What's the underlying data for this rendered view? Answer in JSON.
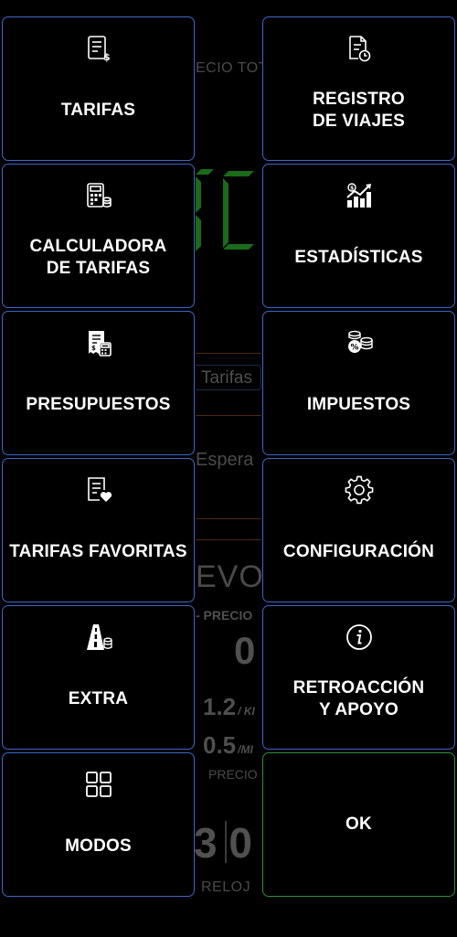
{
  "background": {
    "precio_total": "ECIO TOT",
    "tarifas": "Tarifas",
    "espera": "Espera",
    "nuevo": "EVO V",
    "precio_small": "- PRECIO",
    "zero": "0",
    "rate1": "1.2",
    "rate1_unit": "/ KI",
    "rate2": "0.5",
    "rate2_unit": "/MI",
    "precio": "PRECIO",
    "clock_digits": "3   0",
    "reloj": "RELOJ",
    "digit_color": "#1a6b1a"
  },
  "menu": {
    "tiles": [
      {
        "label": "TARIFAS",
        "icon": "invoice-dollar-icon"
      },
      {
        "label": "REGISTRO\nDE VIAJES",
        "icon": "document-clock-icon"
      },
      {
        "label": "CALCULADORA\nDE TARIFAS",
        "icon": "calculator-coins-icon"
      },
      {
        "label": "ESTADÍSTICAS",
        "icon": "chart-growth-icon"
      },
      {
        "label": "PRESUPUESTOS",
        "icon": "receipt-calculator-icon"
      },
      {
        "label": "IMPUESTOS",
        "icon": "coins-percent-icon"
      },
      {
        "label": "TARIFAS FAVORITAS",
        "icon": "document-heart-icon"
      },
      {
        "label": "CONFIGURACIÓN",
        "icon": "gear-icon"
      },
      {
        "label": "EXTRA",
        "icon": "road-coins-icon"
      },
      {
        "label": "RETROACCIÓN\nY APOYO",
        "icon": "info-icon"
      },
      {
        "label": "MODOS",
        "icon": "grid-icon"
      },
      {
        "label": "OK",
        "icon": ""
      }
    ]
  },
  "colors": {
    "tile_border": "#3d66c7",
    "ok_border": "#2f8f3a",
    "background": "#000000",
    "text": "#ffffff"
  }
}
